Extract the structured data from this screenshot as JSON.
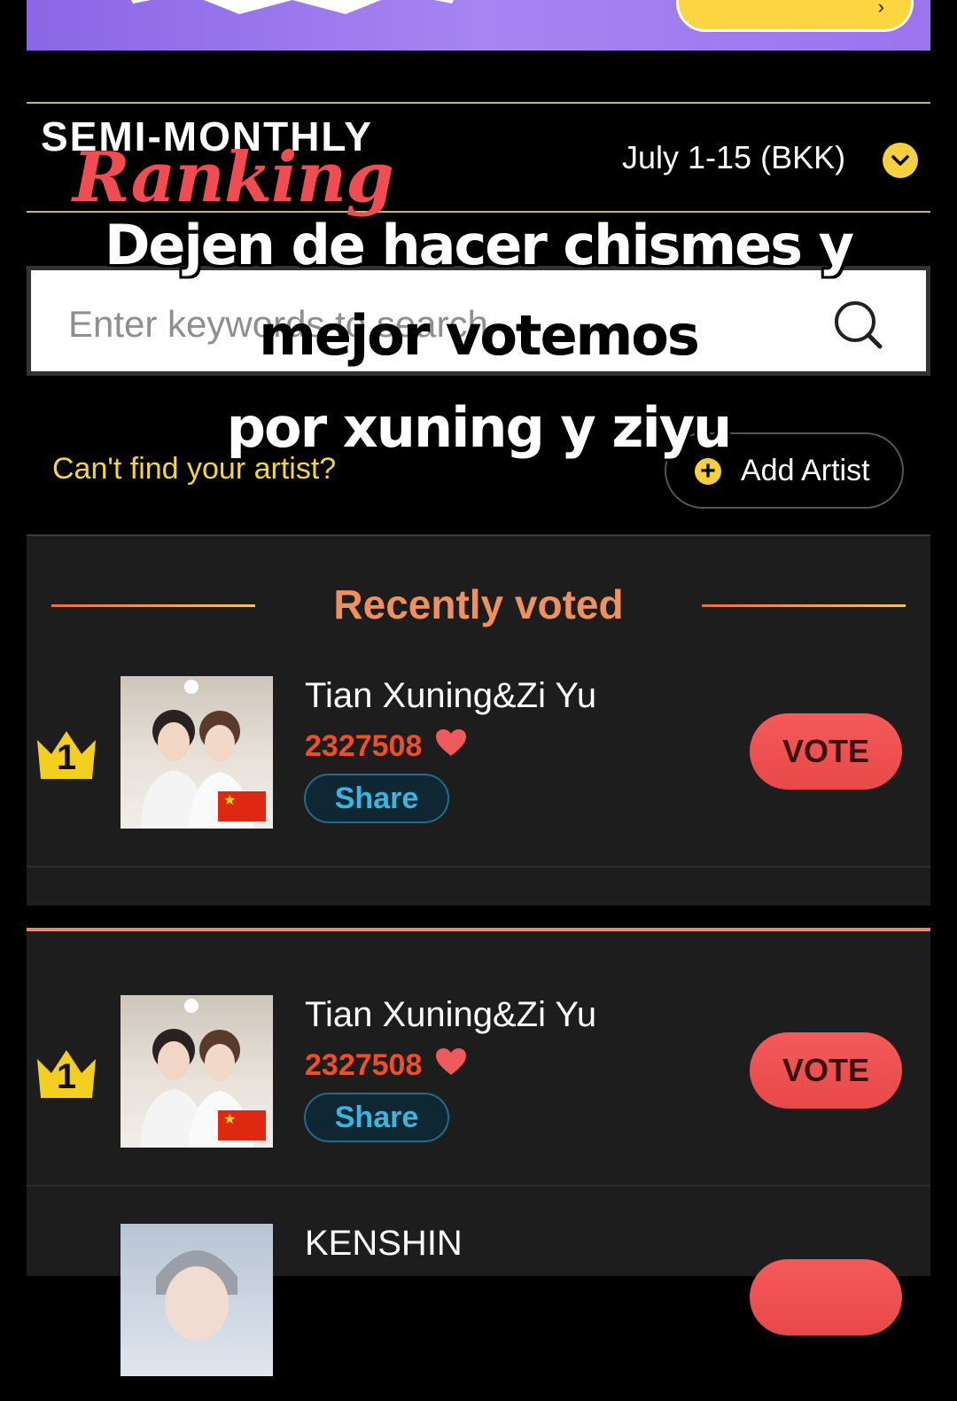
{
  "ranking": {
    "title_line1": "SEMI-MONTHLY",
    "title_line2": "Ranking",
    "period": "July 1-15 (BKK)"
  },
  "search": {
    "placeholder": "Enter keywords to search"
  },
  "add_artist": {
    "prompt": "Can't find your artist?",
    "button_label": "Add Artist"
  },
  "recently_voted": {
    "title": "Recently voted",
    "items": [
      {
        "rank": "1",
        "name": "Tian Xuning&Zi Yu",
        "votes": "2327508",
        "share_label": "Share",
        "vote_label": "VOTE"
      }
    ]
  },
  "ranking_list": {
    "items": [
      {
        "rank": "1",
        "name": "Tian Xuning&Zi Yu",
        "votes": "2327508",
        "share_label": "Share",
        "vote_label": "VOTE"
      },
      {
        "rank": "",
        "name": "KENSHIN",
        "votes": "",
        "share_label": "",
        "vote_label": ""
      }
    ]
  },
  "caption": {
    "line1": "Dejen de hacer chismes y",
    "line2": "mejor votemos",
    "line3": "por xuning y ziyu"
  },
  "colors": {
    "accent_yellow": "#f7d13c",
    "vote_red": "#f04c52",
    "count_orange": "#f04f26",
    "share_blue": "#3ab5e0"
  }
}
